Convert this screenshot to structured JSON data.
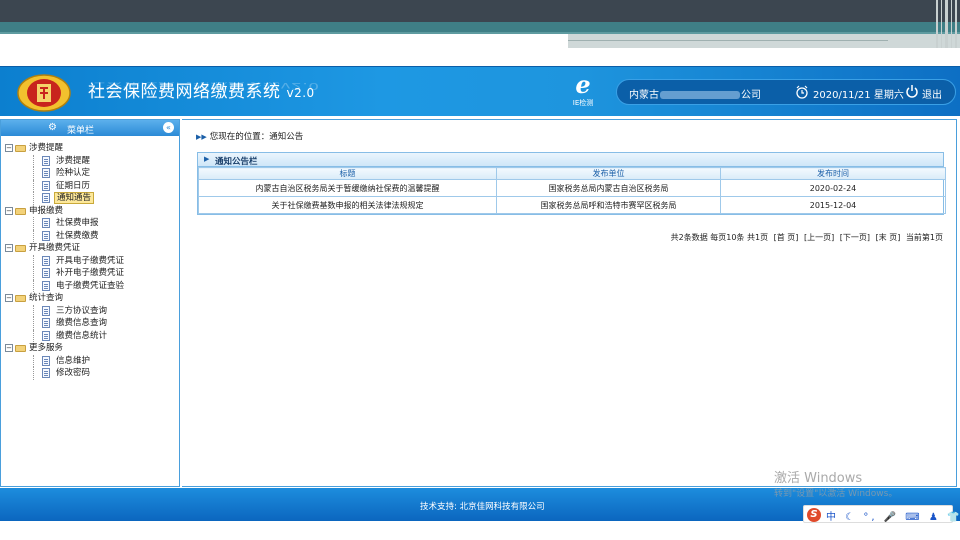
{
  "header": {
    "system_title": "社会保险费网络缴费系统",
    "version": "v2.0",
    "ie_check_label": "IE检测",
    "company_prefix": "内蒙古",
    "company_suffix": "公司",
    "datetime": "2020/11/21 星期六",
    "logout_label": "退出"
  },
  "sidebar": {
    "title": "菜单栏",
    "groups": [
      {
        "label": "涉费提醒",
        "items": [
          "涉费提醒",
          "险种认定",
          "征期日历",
          "通知通告"
        ]
      },
      {
        "label": "申报缴费",
        "items": [
          "社保费申报",
          "社保费缴费"
        ]
      },
      {
        "label": "开具缴费凭证",
        "items": [
          "开具电子缴费凭证",
          "补开电子缴费凭证",
          "电子缴费凭证查验"
        ]
      },
      {
        "label": "统计查询",
        "items": [
          "三方协议查询",
          "缴费信息查询",
          "缴费信息统计"
        ]
      },
      {
        "label": "更多服务",
        "items": [
          "信息维护",
          "修改密码"
        ]
      }
    ],
    "active_item": "通知通告"
  },
  "main": {
    "breadcrumb": "您现在的位置：通知公告",
    "panel_title": "通知公告栏",
    "columns": [
      "标题",
      "发布单位",
      "发布时间"
    ],
    "rows": [
      [
        "内蒙古自治区税务局关于暂缓缴纳社保费的温馨提醒",
        "国家税务总局内蒙古自治区税务局",
        "2020-02-24"
      ],
      [
        "关于社保缴费基数申报的相关法律法规规定",
        "国家税务总局呼和浩特市赛罕区税务局",
        "2015-12-04"
      ]
    ],
    "pager": {
      "summary": "共2条数据 每页10条 共1页",
      "first": "[首 页]",
      "prev": "[上一页]",
      "next": "[下一页]",
      "last": "[末 页]",
      "current": "当前第1页"
    }
  },
  "footer": {
    "support": "技术支持: 北京佳网科技有限公司"
  },
  "watermark": {
    "line1": "激活 Windows",
    "line2": "转到\"设置\"以激活 Windows。"
  },
  "ime": {
    "items": "中 ☾ °, 🎤 ⌨ ♟ 👕 ▦"
  },
  "colors": {
    "header_blue": "#1e98e3",
    "footer_blue": "#0b66bf",
    "active_highlight": "#fde89a"
  }
}
